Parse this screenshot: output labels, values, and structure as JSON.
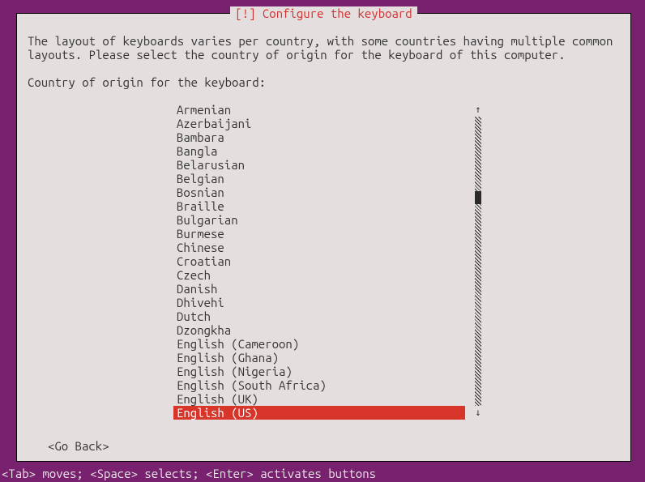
{
  "title": "[!] Configure the keyboard",
  "description": "The layout of keyboards varies per country, with some countries having multiple common\nlayouts. Please select the country of origin for the keyboard of this computer.",
  "prompt": "Country of origin for the keyboard:",
  "items": [
    "Armenian",
    "Azerbaijani",
    "Bambara",
    "Bangla",
    "Belarusian",
    "Belgian",
    "Bosnian",
    "Braille",
    "Bulgarian",
    "Burmese",
    "Chinese",
    "Croatian",
    "Czech",
    "Danish",
    "Dhivehi",
    "Dutch",
    "Dzongkha",
    "English (Cameroon)",
    "English (Ghana)",
    "English (Nigeria)",
    "English (South Africa)",
    "English (UK)",
    "English (US)"
  ],
  "selectedIndex": 22,
  "goBack": "<Go Back>",
  "helpLine": "<Tab> moves; <Space> selects; <Enter> activates buttons",
  "arrows": {
    "up": "↑",
    "down": "↓"
  }
}
